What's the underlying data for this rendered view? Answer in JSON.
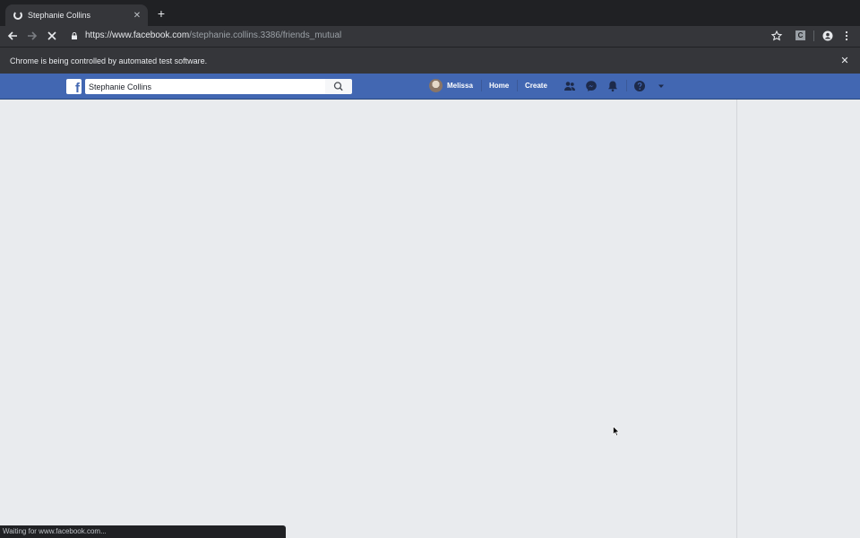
{
  "browser": {
    "tab_title": "Stephanie Collins",
    "url_host": "https://www.facebook.com",
    "url_path": "/stephanie.collins.3386/friends_mutual",
    "extension_label": "C",
    "infobar_text": "Chrome is being controlled by automated test software.",
    "status_text": "Waiting for www.facebook.com..."
  },
  "facebook": {
    "logo_letter": "f",
    "search_value": "Stephanie Collins",
    "user_name": "Melissa",
    "nav_home": "Home",
    "nav_create": "Create",
    "brand_color": "#4267b2"
  },
  "icons": {
    "tab_loading": "spinner-icon",
    "back": "arrow-left-icon",
    "forward": "arrow-right-icon",
    "stop": "close-icon",
    "lock": "lock-icon",
    "bookmark": "star-icon",
    "account": "account-circle-icon",
    "menu": "kebab-menu-icon",
    "search": "search-icon",
    "friends": "friends-icon",
    "messenger": "messenger-icon",
    "notifications": "bell-icon",
    "help": "help-icon",
    "dropdown": "caret-down-icon"
  }
}
